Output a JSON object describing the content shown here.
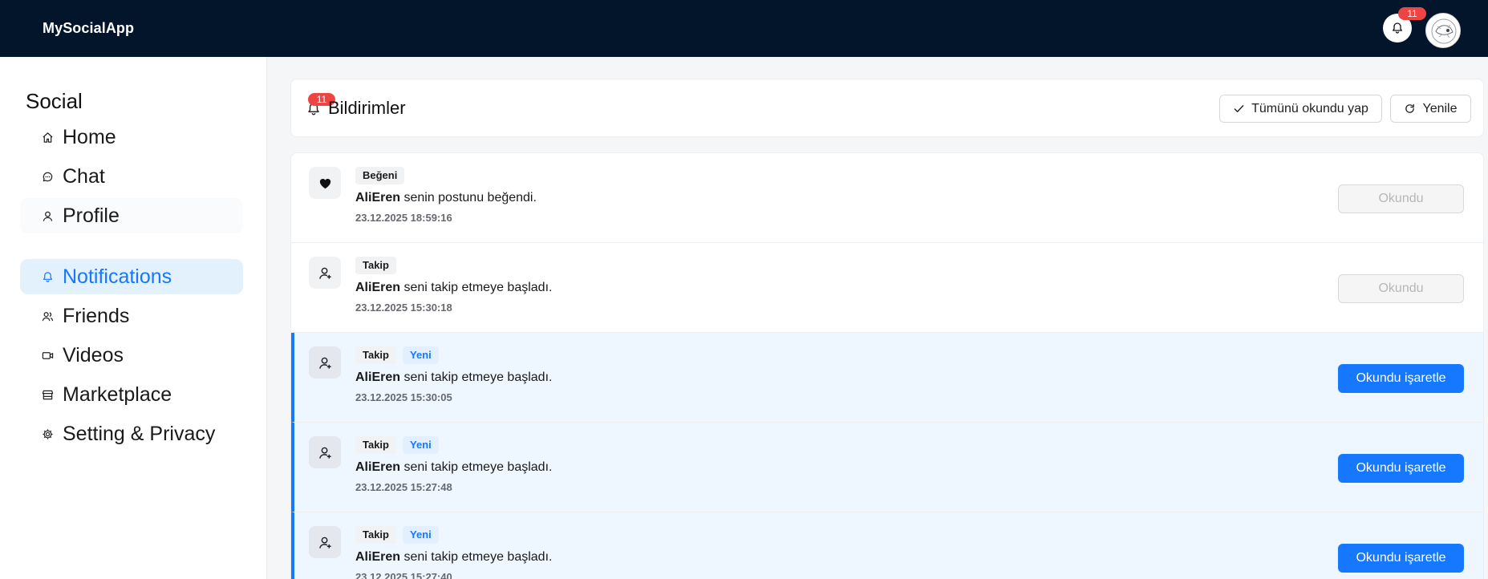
{
  "app": {
    "brand": "MySocialApp",
    "notification_count": "11"
  },
  "sidebar": {
    "title": "Social",
    "items": [
      {
        "label": "Home",
        "icon": "home-icon"
      },
      {
        "label": "Chat",
        "icon": "chat-icon"
      },
      {
        "label": "Profile",
        "icon": "user-icon"
      },
      {
        "label": "Notifications",
        "icon": "bell-icon",
        "active": true
      },
      {
        "label": "Friends",
        "icon": "users-icon"
      },
      {
        "label": "Videos",
        "icon": "video-icon"
      },
      {
        "label": "Marketplace",
        "icon": "shop-icon"
      },
      {
        "label": "Setting & Privacy",
        "icon": "gear-icon"
      }
    ]
  },
  "header": {
    "title": "Bildirimler",
    "badge": "11",
    "mark_all_label": "Tümünü okundu yap",
    "refresh_label": "Yenile"
  },
  "notifications": [
    {
      "type": "Beğeni",
      "icon": "heart-icon",
      "is_new": false,
      "user": "AliEren",
      "text": " senin postunu beğendi.",
      "time": "23.12.2025 18:59:16",
      "action": "Okundu"
    },
    {
      "type": "Takip",
      "icon": "user-plus-icon",
      "is_new": false,
      "user": "AliEren",
      "text": " seni takip etmeye başladı.",
      "time": "23.12.2025 15:30:18",
      "action": "Okundu"
    },
    {
      "type": "Takip",
      "new_label": "Yeni",
      "icon": "user-plus-icon",
      "is_new": true,
      "user": "AliEren",
      "text": " seni takip etmeye başladı.",
      "time": "23.12.2025 15:30:05",
      "action": "Okundu işaretle"
    },
    {
      "type": "Takip",
      "new_label": "Yeni",
      "icon": "user-plus-icon",
      "is_new": true,
      "user": "AliEren",
      "text": " seni takip etmeye başladı.",
      "time": "23.12.2025 15:27:48",
      "action": "Okundu işaretle"
    },
    {
      "type": "Takip",
      "new_label": "Yeni",
      "icon": "user-plus-icon",
      "is_new": true,
      "user": "AliEren",
      "text": " seni takip etmeye başladı.",
      "time": "23.12.2025 15:27:40",
      "action": "Okundu işaretle"
    }
  ],
  "colors": {
    "topbar": "#02152b",
    "accent": "#1677ff",
    "badge": "#ef4444",
    "unread_bg": "#eef6ff"
  }
}
